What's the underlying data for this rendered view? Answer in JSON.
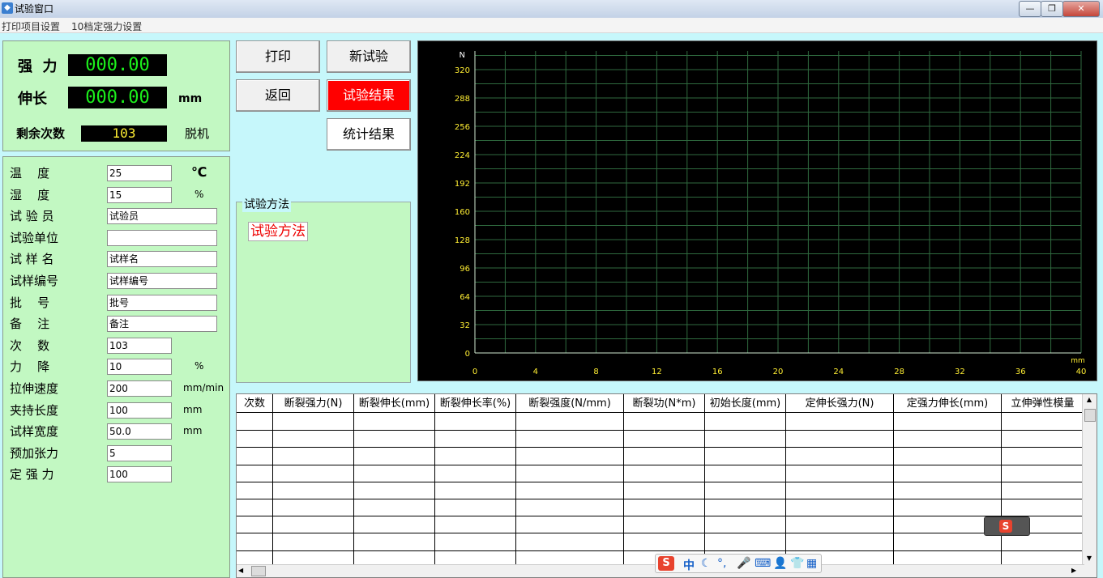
{
  "window": {
    "title": "试验窗口"
  },
  "menu": {
    "items": [
      "打印项目设置",
      "10档定强力设置"
    ]
  },
  "readout": {
    "force_label": "强  力",
    "force_value": "000.00",
    "elong_label": "伸长",
    "elong_value": "000.00",
    "elong_unit": "mm",
    "remain_label": "剩余次数",
    "remain_value": "103",
    "status": "脱机"
  },
  "params": [
    {
      "label": "温    度",
      "value": "25",
      "unit": "℃"
    },
    {
      "label": "湿    度",
      "value": "15",
      "unit": "%"
    },
    {
      "label": "试 验 员",
      "value": "试验员",
      "unit": ""
    },
    {
      "label": "试验单位",
      "value": "",
      "unit": ""
    },
    {
      "label": "试 样 名",
      "value": "试样名",
      "unit": ""
    },
    {
      "label": "试样编号",
      "value": "试样编号",
      "unit": ""
    },
    {
      "label": "批    号",
      "value": "批号",
      "unit": ""
    },
    {
      "label": "备    注",
      "value": "备注",
      "unit": ""
    },
    {
      "label": "次    数",
      "value": "103",
      "unit": ""
    },
    {
      "label": "力    降",
      "value": "10",
      "unit": "%"
    },
    {
      "label": "拉伸速度",
      "value": "200",
      "unit": "mm/min"
    },
    {
      "label": "夹持长度",
      "value": "100",
      "unit": "mm"
    },
    {
      "label": "试样宽度",
      "value": "50.0",
      "unit": "mm"
    },
    {
      "label": "预加张力",
      "value": "5",
      "unit": ""
    },
    {
      "label": "定 强 力",
      "value": "100",
      "unit": ""
    }
  ],
  "buttons": {
    "print": "打印",
    "new_test": "新试验",
    "back": "返回",
    "test_result": "试验结果",
    "stats_result": "统计结果"
  },
  "method": {
    "legend": "试验方法",
    "value": "试验方法"
  },
  "chart_data": {
    "type": "line",
    "ylabel": "N",
    "xlabel": "mm",
    "yticks": [
      0,
      32,
      64,
      96,
      128,
      160,
      192,
      224,
      256,
      288,
      320
    ],
    "xticks": [
      0,
      4,
      8,
      12,
      16,
      20,
      24,
      28,
      32,
      36,
      40
    ],
    "ylim": [
      0,
      320
    ],
    "xlim": [
      0,
      40
    ],
    "grid": true,
    "series": []
  },
  "table": {
    "headers": [
      "次数",
      "断裂强力(N)",
      "断裂伸长(mm)",
      "断裂伸长率(%)",
      "断裂强度(N/mm)",
      "断裂功(N*m)",
      "初始长度(mm)",
      "定伸长强力(N)",
      "定强力伸长(mm)",
      "立伸弹性模量"
    ]
  },
  "ime": {
    "lang": "中"
  },
  "colors": {
    "lcd_green": "#1cf01c",
    "lcd_yellow": "#ffee33",
    "panel_green": "#c2f8c2",
    "chart_grid": "#2f6a3f",
    "chart_tick": "#ffee33"
  }
}
